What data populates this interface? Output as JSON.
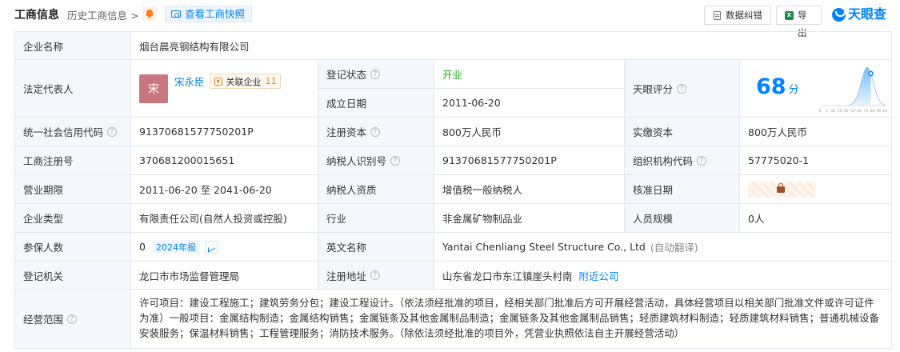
{
  "header": {
    "title": "工商信息",
    "history": "历史工商信息 >",
    "snapshot_button": "查看工商快照",
    "error_button": "数据纠错",
    "export_button": "导出",
    "logo_text": "天眼查",
    "excel_icon_letter": "X"
  },
  "company": {
    "name_label": "企业名称",
    "name": "烟台晨亮钢结构有限公司"
  },
  "legal_rep": {
    "label": "法定代表人",
    "avatar_char": "宋",
    "name": "宋永臣",
    "assoc_label": "关联企业",
    "assoc_count": "11"
  },
  "status": {
    "label": "登记状态",
    "value": "开业"
  },
  "established": {
    "label": "成立日期",
    "value": "2011-06-20"
  },
  "score": {
    "label": "天眼评分",
    "value": "68",
    "unit": "分",
    "level": 0.68,
    "axis_ticks": [
      "0",
      "1",
      "10",
      "25",
      "40",
      "50",
      "60",
      "70",
      "80",
      "90",
      "100"
    ]
  },
  "credit_code": {
    "label": "统一社会信用代码",
    "value": "91370681577750201P"
  },
  "reg_capital": {
    "label": "注册资本",
    "value": "800万人民币"
  },
  "paid_capital": {
    "label": "实缴资本",
    "value": "800万人民币"
  },
  "reg_no": {
    "label": "工商注册号",
    "value": "370681200015651"
  },
  "taxpayer_id": {
    "label": "纳税人识别号",
    "value": "91370681577750201P"
  },
  "org_code": {
    "label": "组织机构代码",
    "value": "57775020-1"
  },
  "term": {
    "label": "营业期限",
    "value": "2011-06-20 至 2041-06-20"
  },
  "taxpayer_type": {
    "label": "纳税人资质",
    "value": "增值税一般纳税人"
  },
  "approval_date": {
    "label": "核准日期"
  },
  "company_type": {
    "label": "企业类型",
    "value": "有限责任公司(自然人投资或控股)"
  },
  "industry": {
    "label": "行业",
    "value": "非金属矿物制品业"
  },
  "staff_size": {
    "label": "人员规模",
    "value": "0人"
  },
  "insured": {
    "label": "参保人数",
    "value": "0",
    "report_tag": "2024年报"
  },
  "english_name": {
    "label": "英文名称",
    "value": "Yantai Chenliang Steel Structure Co., Ltd",
    "note": "(自动翻译)"
  },
  "authority": {
    "label": "登记机关",
    "value": "龙口市市场监督管理局"
  },
  "address": {
    "label": "注册地址",
    "value": "山东省龙口市东江镇崖头村南",
    "nearby_link": "附近公司"
  },
  "scope": {
    "label": "经营范围",
    "value": "许可项目：建设工程施工；建筑劳务分包；建设工程设计。（依法须经批准的项目，经相关部门批准后方可开展经营活动，具体经营项目以相关部门批准文件或许可证件为准）一般项目：金属结构制造；金属结构销售；金属链条及其他金属制品制造；金属链条及其他金属制品销售；轻质建筑材料制造；轻质建筑材料销售；普通机械设备安装服务；保温材料销售；工程管理服务；消防技术服务。（除依法须经批准的项目外，凭营业执照依法自主开展经营活动）"
  },
  "colors": {
    "accent": "#0084ff",
    "status_green": "#1aad19",
    "label_bg": "#f4f8fc",
    "avatar": "#c9777e"
  }
}
